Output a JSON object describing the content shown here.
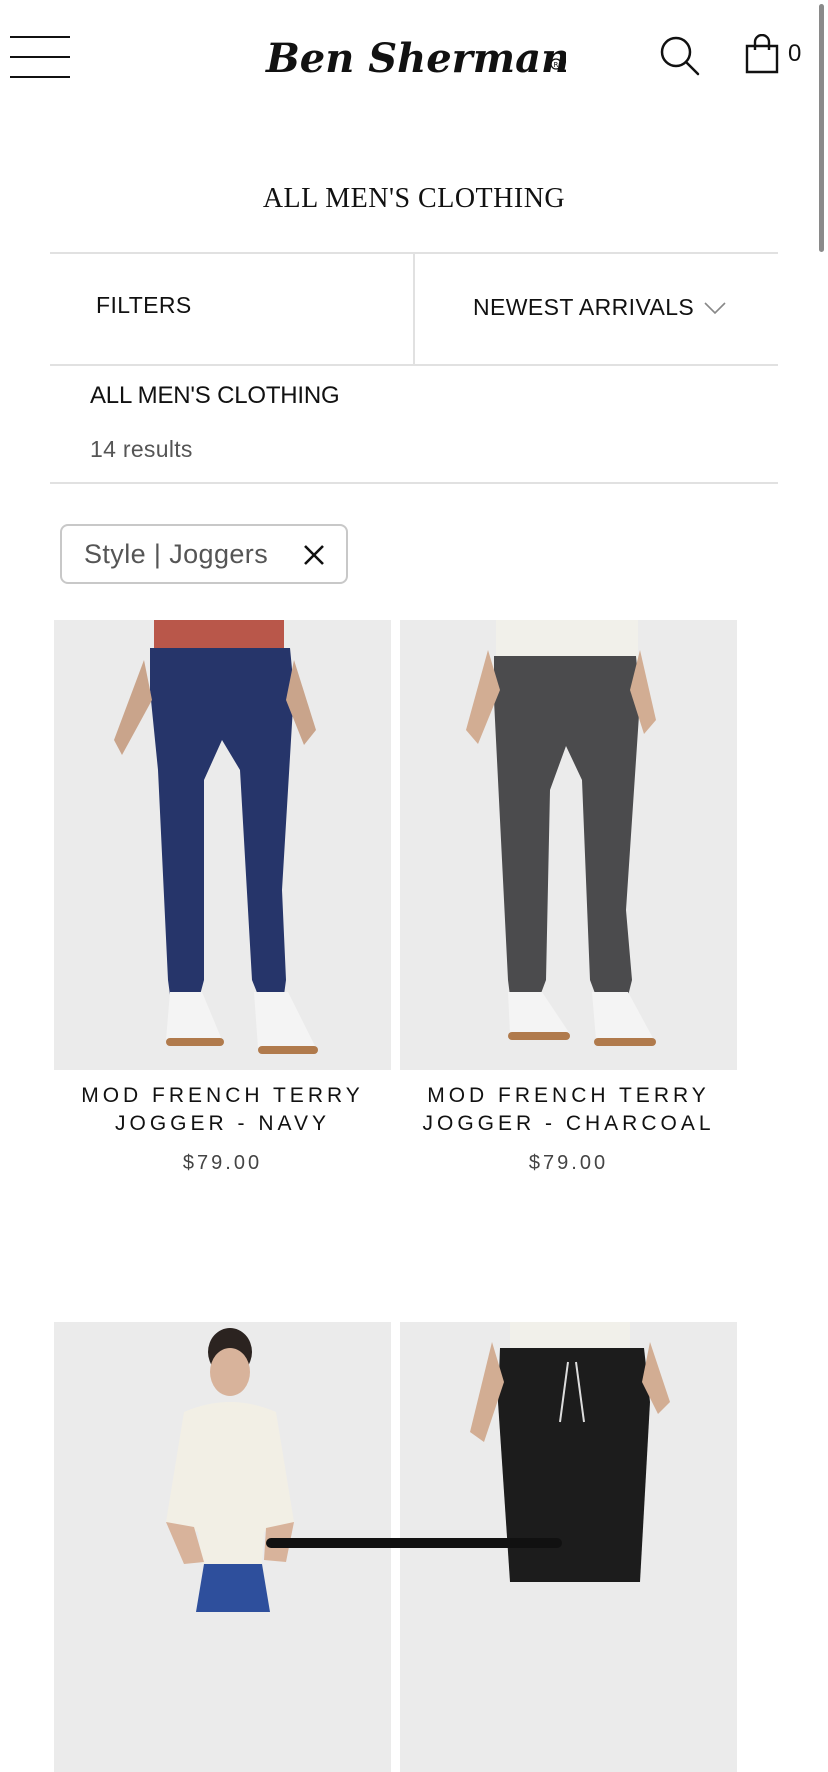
{
  "header": {
    "brand": "Ben Sherman",
    "cart_count": "0",
    "icons": {
      "menu": "hamburger-menu-icon",
      "search": "search-icon",
      "cart": "shopping-bag-icon"
    }
  },
  "page": {
    "title": "ALL MEN'S CLOTHING",
    "filters_label": "FILTERS",
    "sort_label": "NEWEST ARRIVALS",
    "collection_title": "ALL MEN'S CLOTHING",
    "results": "14 results",
    "active_filter": "Style | Joggers"
  },
  "products": [
    {
      "name_line1": "MOD FRENCH TERRY",
      "name_line2": "JOGGER - NAVY",
      "price": "$79.00",
      "color": "#26356a"
    },
    {
      "name_line1": "MOD FRENCH TERRY",
      "name_line2": "JOGGER - CHARCOAL",
      "price": "$79.00",
      "color": "#4b4b4d"
    },
    {
      "name_line1": "",
      "name_line2": "",
      "price": "",
      "color": "#2e4f9c"
    },
    {
      "name_line1": "",
      "name_line2": "",
      "price": "",
      "color": "#1c1c1c"
    }
  ],
  "colors": {
    "divider": "#e1e1e1",
    "chip_border": "#c8c8c8",
    "photo_bg": "#ebebeb"
  }
}
